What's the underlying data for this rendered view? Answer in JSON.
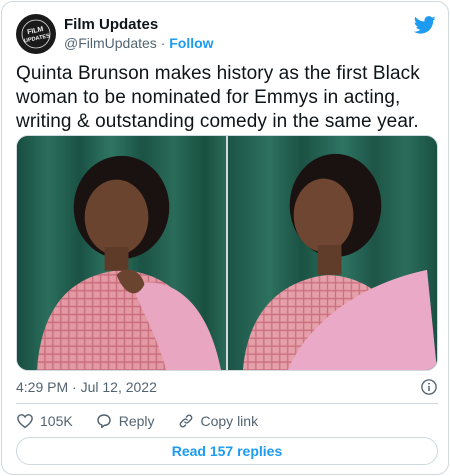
{
  "author": {
    "display_name": "Film Updates",
    "handle": "@FilmUpdates",
    "separator": "·",
    "follow_label": "Follow",
    "avatar_text": "FILM UPDATES"
  },
  "tweet": {
    "text": "Quinta Brunson makes history as the first Black woman to be nominated for Emmys in acting, writing & outstanding comedy in the same year."
  },
  "media": {
    "photos": [
      {
        "icon": "photo-left",
        "backdrop_color": "#1f5a4a",
        "dress_color": "#e6a1a8"
      },
      {
        "icon": "photo-right",
        "backdrop_color": "#245e50",
        "dress_color": "#e8a4b0"
      }
    ]
  },
  "meta": {
    "time": "4:29 PM · Jul 12, 2022"
  },
  "actions": {
    "like_count": "105K",
    "reply_label": "Reply",
    "copy_label": "Copy link"
  },
  "replies_button": "Read 157 replies",
  "colors": {
    "accent": "#1d9bf0",
    "text": "#0f1419",
    "muted": "#536471",
    "border": "#cfd9de"
  }
}
